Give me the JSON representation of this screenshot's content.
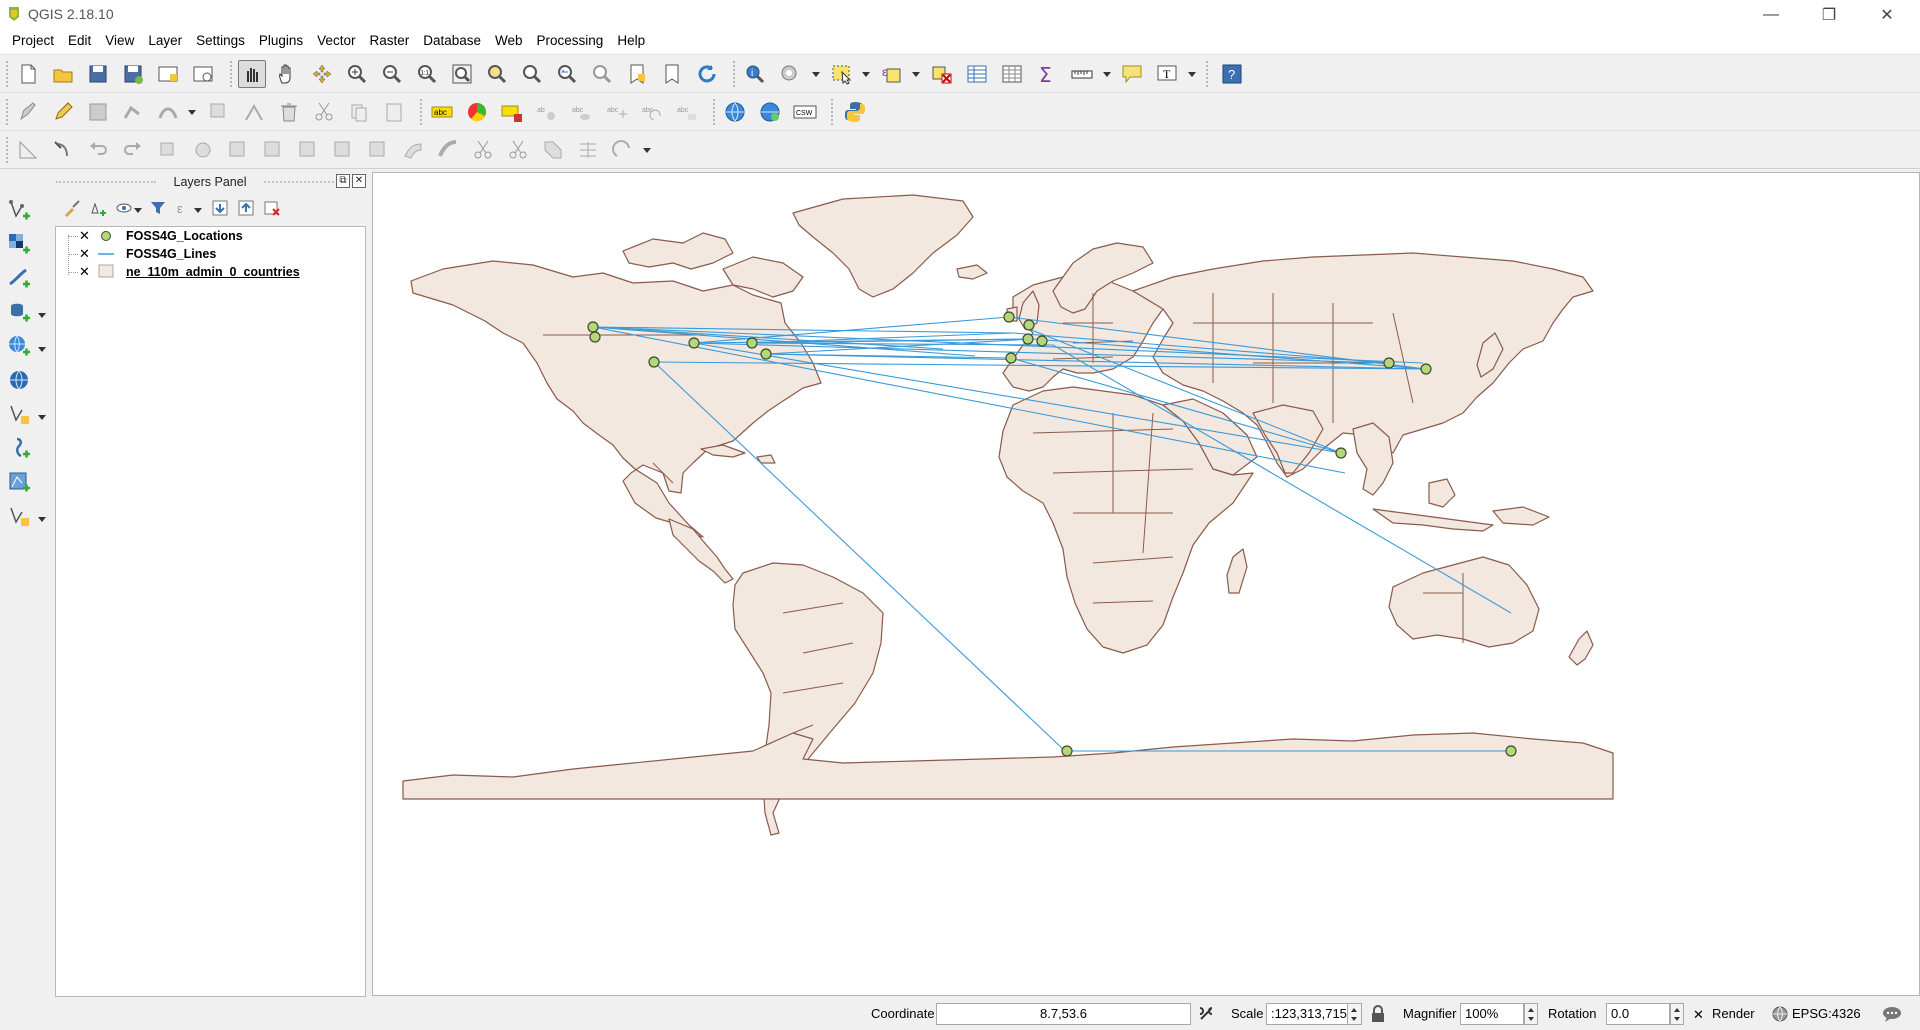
{
  "app": {
    "title": "QGIS 2.18.10"
  },
  "window_controls": {
    "minimize": "—",
    "maximize": "❐",
    "close": "✕"
  },
  "menu": [
    "Project",
    "Edit",
    "View",
    "Layer",
    "Settings",
    "Plugins",
    "Vector",
    "Raster",
    "Database",
    "Web",
    "Processing",
    "Help"
  ],
  "toolbar": {
    "label_tool_text": "abc",
    "csw_text": "CSW",
    "text_tool_text": "T",
    "help_text": "?",
    "zoom_native_text": "1:1"
  },
  "layers_panel": {
    "title": "Layers Panel",
    "layers": [
      {
        "name": "FOSS4G_Locations",
        "checked": "✕",
        "type": "point"
      },
      {
        "name": "FOSS4G_Lines",
        "checked": "✕",
        "type": "line"
      },
      {
        "name": "ne_110m_admin_0_countries",
        "checked": "✕",
        "type": "polygon"
      }
    ]
  },
  "map": {
    "land_fill": "#f2e8e0",
    "border_color": "#8a5a4a",
    "line_color": "#3a9ad9",
    "point_fill": "#b4d77a",
    "point_stroke": "#3d4a2a"
  },
  "statusbar": {
    "coordinate_label": "Coordinate",
    "coordinate_value": "8.7,53.6",
    "scale_label": "Scale",
    "scale_value": ":123,313,715",
    "magnifier_label": "Magnifier",
    "magnifier_value": "100%",
    "rotation_label": "Rotation",
    "rotation_value": "0.0",
    "render_check": "✕",
    "render_label": "Render",
    "crs_label": "EPSG:4326"
  }
}
